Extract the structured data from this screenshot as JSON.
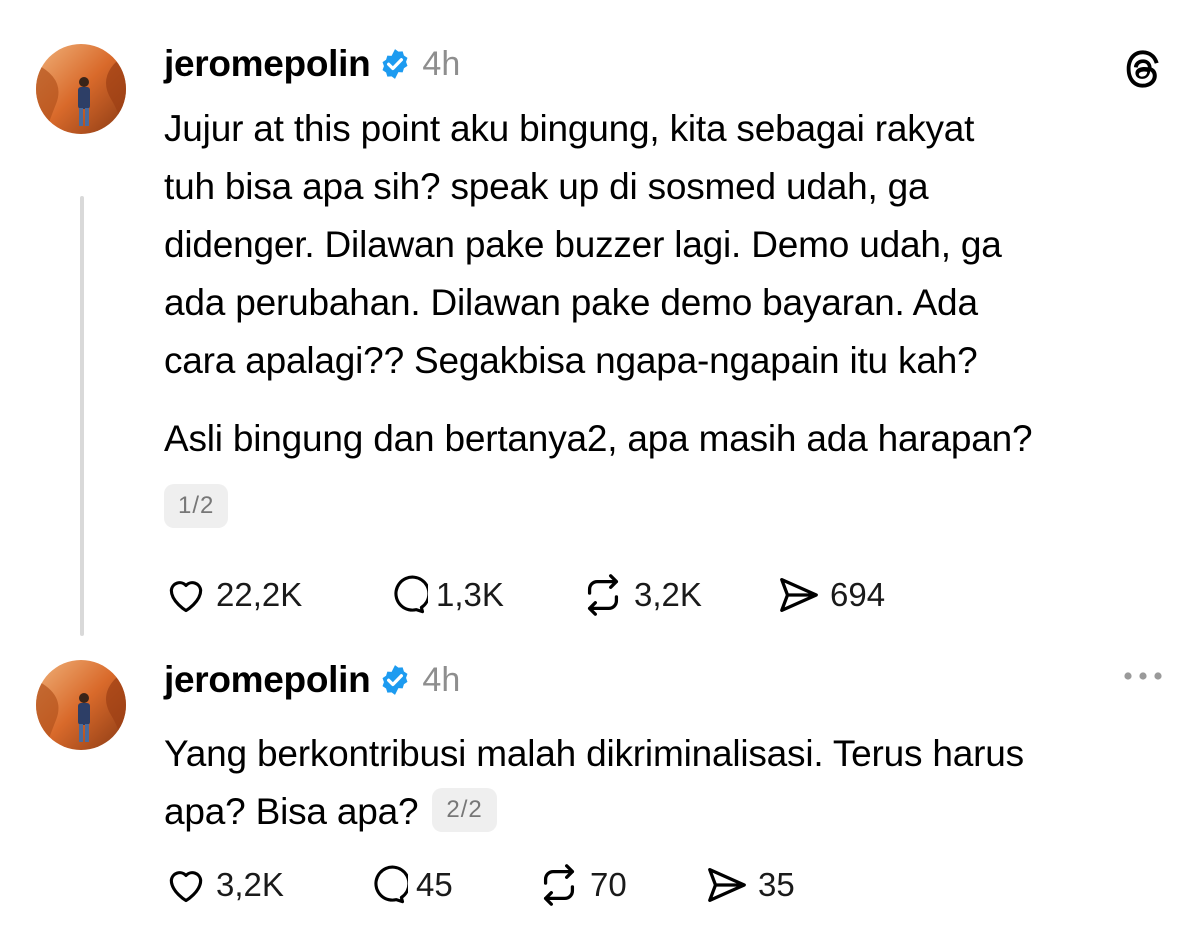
{
  "posts": [
    {
      "username": "jeromepolin",
      "time": "4h",
      "lines_p1": [
        "Jujur at this point aku bingung, kita sebagai rakyat",
        "tuh bisa apa sih? speak up di sosmed udah, ga",
        "didenger. Dilawan pake buzzer lagi. Demo udah, ga",
        "ada perubahan. Dilawan pake demo bayaran. Ada",
        "cara apalagi?? Segakbisa ngapa-ngapain itu kah?"
      ],
      "lines_p2": [
        "Asli bingung dan bertanya2, apa masih ada harapan?"
      ],
      "counter": "1/2",
      "likes": "22,2K",
      "replies": "1,3K",
      "reposts": "3,2K",
      "shares": "694"
    },
    {
      "username": "jeromepolin",
      "time": "4h",
      "lines_p1": [
        "Yang berkontribusi malah dikriminalisasi. Terus harus",
        "apa? Bisa apa?"
      ],
      "counter": "2/2",
      "likes": "3,2K",
      "replies": "45",
      "reposts": "70",
      "shares": "35"
    }
  ],
  "icons": {
    "top_right": "threads-logo-icon",
    "more": "more-dots-icon",
    "verified": "verified-badge-icon",
    "like": "heart-icon",
    "reply": "comment-icon",
    "repost": "repost-icon",
    "share": "send-icon"
  },
  "colors": {
    "verified": "#1D9BF0",
    "muted": "#8E8E8E",
    "thread_line": "#D9D9D9"
  }
}
